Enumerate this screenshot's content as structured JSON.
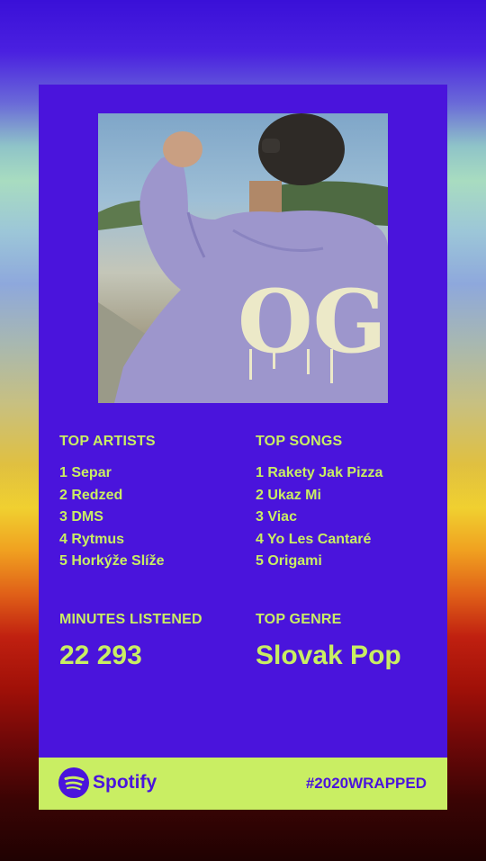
{
  "top_artists": {
    "title": "TOP ARTISTS",
    "items": [
      "1 Separ",
      "2 Redzed",
      "3 DMS",
      "4 Rytmus",
      "5 Horkýže Slíže"
    ]
  },
  "top_songs": {
    "title": "TOP SONGS",
    "items": [
      "1 Rakety Jak Pizza",
      "2 Ukaz Mi",
      "3 Viac",
      "4 Yo Les Cantaré",
      "5 Origami"
    ]
  },
  "minutes": {
    "title": "MINUTES LISTENED",
    "value": "22 293"
  },
  "genre": {
    "title": "TOP GENRE",
    "value": "Slovak Pop"
  },
  "photo": {
    "shirt_text": "OG"
  },
  "footer": {
    "brand": "Spotify",
    "hashtag": "#2020WRAPPED"
  },
  "colors": {
    "card": "#4a14dc",
    "accent": "#c9ee63"
  },
  "icons": {
    "brand": "spotify-logo-icon"
  }
}
